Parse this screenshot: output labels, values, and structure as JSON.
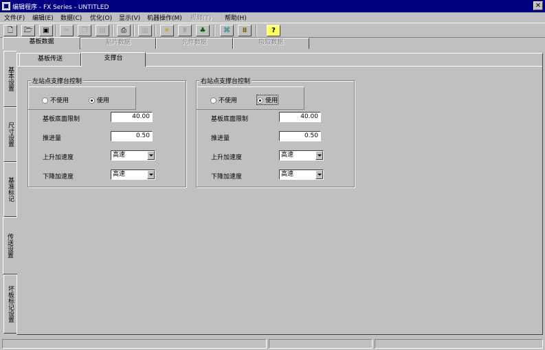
{
  "window": {
    "title": "编辑程序 - FX Series - UNTITLED",
    "close_glyph": "✕"
  },
  "menu": [
    {
      "label": "文件(F)",
      "enabled": true
    },
    {
      "label": "编辑(E)",
      "enabled": true
    },
    {
      "label": "数据(C)",
      "enabled": true
    },
    {
      "label": "优化(O)",
      "enabled": true
    },
    {
      "label": "显示(V)",
      "enabled": true
    },
    {
      "label": "机器操作(M)",
      "enabled": true
    },
    {
      "label": "视频(T)",
      "enabled": false
    },
    {
      "label": "帮助(H)",
      "enabled": true
    }
  ],
  "toolbar": {
    "buttons": [
      {
        "icon": "new-file-icon",
        "glyph": "🗋",
        "enabled": true
      },
      {
        "icon": "open-folder-icon",
        "glyph": "🗁",
        "enabled": true
      },
      {
        "icon": "save-icon",
        "glyph": "▣",
        "enabled": true
      },
      {
        "icon": "cut-icon",
        "glyph": "✂",
        "enabled": false
      },
      {
        "icon": "copy-icon",
        "glyph": "❐",
        "enabled": false
      },
      {
        "icon": "paste-icon",
        "glyph": "▤",
        "enabled": false
      },
      {
        "icon": "print-icon",
        "glyph": "⎙",
        "enabled": true
      },
      {
        "icon": "book-icon",
        "glyph": "▥",
        "enabled": false
      },
      {
        "icon": "lightbulb-icon",
        "glyph": "☀",
        "enabled": true
      },
      {
        "icon": "tool-icon",
        "glyph": "♜",
        "enabled": false
      },
      {
        "icon": "optimize-icon",
        "glyph": "♣",
        "enabled": true
      },
      {
        "icon": "machine-icon",
        "glyph": "⌘",
        "enabled": true
      },
      {
        "icon": "pause-icon",
        "glyph": "Ⅱ",
        "enabled": true
      },
      {
        "icon": "help-icon",
        "glyph": "?",
        "enabled": true
      }
    ]
  },
  "top_tabs": [
    {
      "label": "基板数据",
      "enabled": true,
      "active": true
    },
    {
      "label": "贴片数据",
      "enabled": false,
      "active": false
    },
    {
      "label": "元件数据",
      "enabled": false,
      "active": false
    },
    {
      "label": "吸取数据",
      "enabled": false,
      "active": false
    }
  ],
  "side_tabs": [
    {
      "label": "基本设置"
    },
    {
      "label": "尺寸设置"
    },
    {
      "label": "基准标记"
    },
    {
      "label": "传送设置"
    },
    {
      "label": "坏板标记设置"
    }
  ],
  "sub_tabs": [
    {
      "label": "基板传送",
      "active": false
    },
    {
      "label": "支撑台",
      "active": true
    }
  ],
  "left_group": {
    "title": "左站点支撑台控制",
    "radio_off": "不使用",
    "radio_on": "使用",
    "selected": "使用",
    "rows": [
      {
        "label": "基板底面限制",
        "value": "40.00"
      },
      {
        "label": "推进量",
        "value": "0.50"
      }
    ],
    "selects": [
      {
        "label": "上升加速度",
        "value": "高速"
      },
      {
        "label": "下降加速度",
        "value": "高速"
      }
    ]
  },
  "right_group": {
    "title": "右站点支撑台控制",
    "radio_off": "不使用",
    "radio_on": "使用",
    "selected": "使用",
    "rows": [
      {
        "label": "基板底面限制",
        "value": "40.00"
      },
      {
        "label": "推进量",
        "value": "0.50"
      }
    ],
    "selects": [
      {
        "label": "上升加速度",
        "value": "高速"
      },
      {
        "label": "下降加速度",
        "value": "高速"
      }
    ]
  },
  "colors": {
    "face": "#c0c0c0",
    "titlebar": "#000080"
  }
}
